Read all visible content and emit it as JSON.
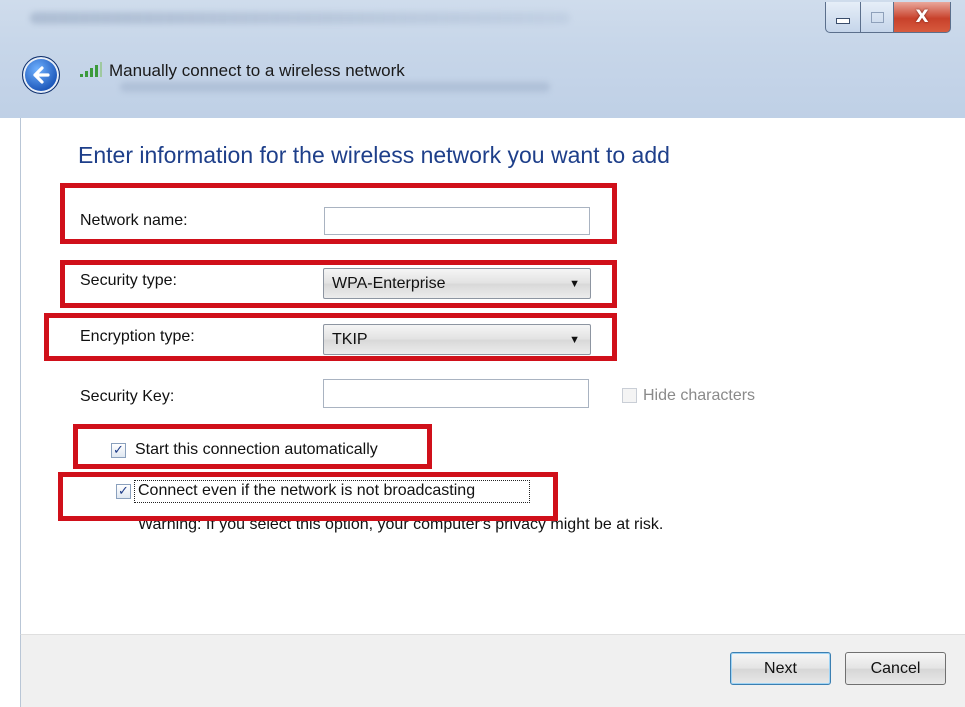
{
  "window": {
    "title": "Manually connect to a wireless network",
    "controls": {
      "minimize_icon": "minimize-icon",
      "maximize_icon": "maximize-icon",
      "close_glyph": "X"
    }
  },
  "form": {
    "heading": "Enter information for the wireless network you want to add",
    "network_name": {
      "label": "Network name:",
      "value": ""
    },
    "security_type": {
      "label": "Security type:",
      "value": "WPA-Enterprise"
    },
    "encryption_type": {
      "label": "Encryption type:",
      "value": "TKIP"
    },
    "security_key": {
      "label": "Security Key:",
      "value": ""
    },
    "hide_characters": {
      "label": "Hide characters",
      "checked": false,
      "enabled": false
    },
    "start_automatically": {
      "label": "Start this connection automatically",
      "checked": true
    },
    "connect_not_broadcasting": {
      "label": "Connect even if the network is not broadcasting",
      "checked": true
    },
    "warning": "Warning: If you select this option, your computer's privacy might be at risk."
  },
  "buttons": {
    "next": "Next",
    "cancel": "Cancel"
  },
  "check_glyph": "✓",
  "colors": {
    "highlight_box": "#d0101a",
    "heading": "#1e3f8a",
    "back_button": "#1a55b8"
  }
}
